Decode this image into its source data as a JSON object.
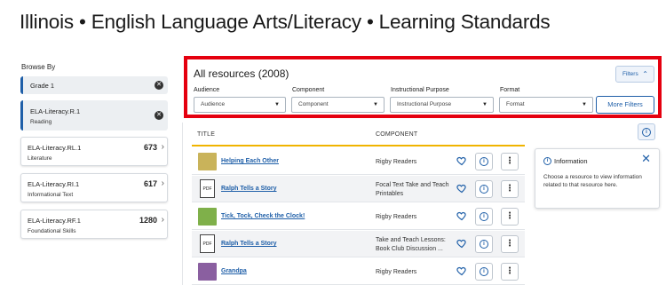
{
  "page_title": "Illinois • English Language Arts/Literacy • Learning Standards",
  "sidebar": {
    "label": "Browse By",
    "selected": [
      {
        "title": "Grade 1",
        "subtitle": ""
      },
      {
        "title": "ELA-Literacy.R.1",
        "subtitle": "Reading"
      }
    ],
    "cards": [
      {
        "title": "ELA-Literacy.RL.1",
        "subtitle": "Literature",
        "count": "673"
      },
      {
        "title": "ELA-Literacy.RI.1",
        "subtitle": "Informational Text",
        "count": "617"
      },
      {
        "title": "ELA-Literacy.RF.1",
        "subtitle": "Foundational Skills",
        "count": "1280"
      }
    ]
  },
  "filters": {
    "heading": "All resources (2008)",
    "toggle_label": "Filters",
    "more_label": "More Filters",
    "dropdowns": [
      {
        "label": "Audience",
        "value": "Audience"
      },
      {
        "label": "Component",
        "value": "Component"
      },
      {
        "label": "Instructional Purpose",
        "value": "Instructional Purpose"
      },
      {
        "label": "Format",
        "value": "Format"
      }
    ]
  },
  "table": {
    "columns": [
      "TITLE",
      "COMPONENT"
    ],
    "rows": [
      {
        "title": "Helping Each Other",
        "component": "Rigby Readers",
        "thumb": "cover-image",
        "thumb_color": "#c9b35a"
      },
      {
        "title": "Ralph Tells a Story",
        "component": "Focal Text Take and Teach Printables",
        "thumb": "pdf-icon",
        "thumb_label": "PDF"
      },
      {
        "title": "Tick, Tock, Check the Clock!",
        "component": "Rigby Readers",
        "thumb": "cover-image",
        "thumb_color": "#7fb04a"
      },
      {
        "title": "Ralph Tells a Story",
        "component": "Take and Teach Lessons: Book Club Discussion ...",
        "thumb": "pdf-icon",
        "thumb_label": "PDF"
      },
      {
        "title": "Grandpa",
        "component": "Rigby Readers",
        "thumb": "cover-image",
        "thumb_color": "#8a5fa0"
      }
    ]
  },
  "info_panel": {
    "title": "Information",
    "body": "Choose a resource to view information related to that resource here."
  },
  "colors": {
    "accent": "#1f5fa8",
    "highlight_box": "#e5000f",
    "header_underline": "#f0b400"
  }
}
